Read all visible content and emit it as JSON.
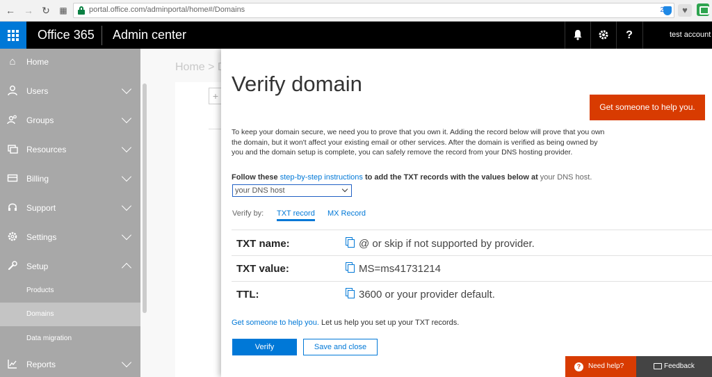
{
  "browser": {
    "url": "portal.office.com/adminportal/home#/Domains",
    "extension_count": "2"
  },
  "header": {
    "brand": "Office 365",
    "title": "Admin center",
    "help_glyph": "?",
    "account": "test account"
  },
  "sidebar": {
    "items": [
      {
        "label": "Home",
        "icon": "home-icon"
      },
      {
        "label": "Users",
        "icon": "user-icon"
      },
      {
        "label": "Groups",
        "icon": "groups-icon"
      },
      {
        "label": "Resources",
        "icon": "resources-icon"
      },
      {
        "label": "Billing",
        "icon": "billing-icon"
      },
      {
        "label": "Support",
        "icon": "headset-icon"
      },
      {
        "label": "Settings",
        "icon": "gear-icon"
      },
      {
        "label": "Setup",
        "icon": "wrench-icon"
      },
      {
        "label": "Reports",
        "icon": "chart-icon"
      }
    ],
    "sub_items": [
      "Products",
      "Domains",
      "Data migration"
    ],
    "active_sub": "Domains"
  },
  "background": {
    "breadcrumb": "Home > D",
    "plus": "+"
  },
  "panel": {
    "title": "Verify domain",
    "help_button": "Get someone to help you.",
    "intro": "To keep your domain secure, we need you to prove that you own it. Adding the record below will prove that you own the domain, but it won't affect your existing email or other services. After the domain is verified as being owned by you and the domain setup is complete, you can safely remove the record from your DNS hosting provider.",
    "follow_prefix": "Follow these",
    "follow_link": "step-by-step instructions",
    "follow_middle": "to add the TXT records with the values below at",
    "follow_suffix": "your DNS host.",
    "dns_select_value": "your DNS host",
    "verify_by_label": "Verify by:",
    "tabs": [
      "TXT record",
      "MX Record"
    ],
    "records": [
      {
        "label": "TXT name:",
        "value": "@ or skip if not supported by provider."
      },
      {
        "label": "TXT value:",
        "value": "MS=ms41731214"
      },
      {
        "label": "TTL:",
        "value": "3600 or your provider default."
      }
    ],
    "help_link": "Get someone to help you.",
    "help_text": "Let us help you set up your TXT records.",
    "verify_button": "Verify",
    "save_button": "Save and close"
  },
  "footer": {
    "need_help": "Need help?",
    "feedback": "Feedback"
  },
  "colors": {
    "accent": "#0078d7",
    "orange": "#d83b01",
    "header_bg": "#000000",
    "sidebar_bg": "#a8a8a8"
  }
}
